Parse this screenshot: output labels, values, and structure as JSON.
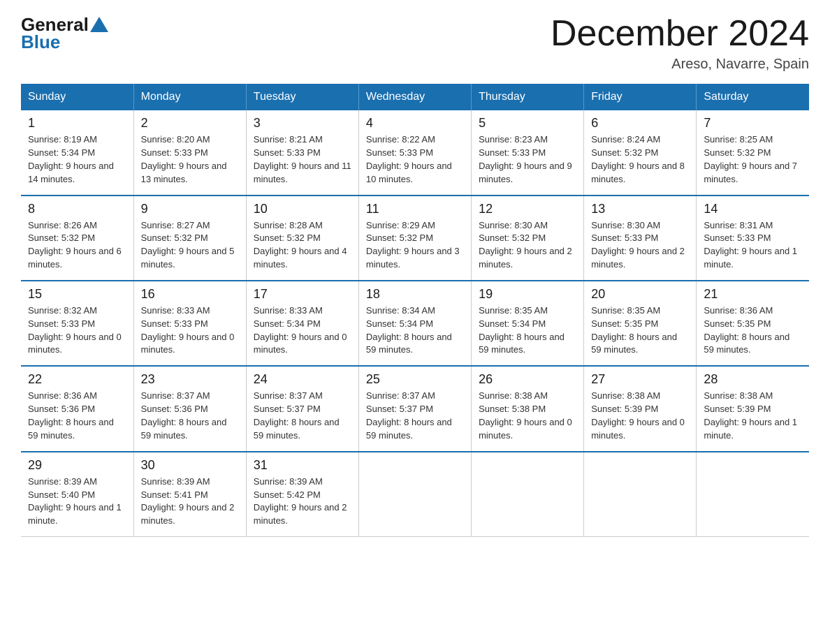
{
  "header": {
    "logo_general": "General",
    "logo_blue": "Blue",
    "title": "December 2024",
    "subtitle": "Areso, Navarre, Spain"
  },
  "days_of_week": [
    "Sunday",
    "Monday",
    "Tuesday",
    "Wednesday",
    "Thursday",
    "Friday",
    "Saturday"
  ],
  "weeks": [
    [
      {
        "day": "1",
        "sunrise": "8:19 AM",
        "sunset": "5:34 PM",
        "daylight": "9 hours and 14 minutes."
      },
      {
        "day": "2",
        "sunrise": "8:20 AM",
        "sunset": "5:33 PM",
        "daylight": "9 hours and 13 minutes."
      },
      {
        "day": "3",
        "sunrise": "8:21 AM",
        "sunset": "5:33 PM",
        "daylight": "9 hours and 11 minutes."
      },
      {
        "day": "4",
        "sunrise": "8:22 AM",
        "sunset": "5:33 PM",
        "daylight": "9 hours and 10 minutes."
      },
      {
        "day": "5",
        "sunrise": "8:23 AM",
        "sunset": "5:33 PM",
        "daylight": "9 hours and 9 minutes."
      },
      {
        "day": "6",
        "sunrise": "8:24 AM",
        "sunset": "5:32 PM",
        "daylight": "9 hours and 8 minutes."
      },
      {
        "day": "7",
        "sunrise": "8:25 AM",
        "sunset": "5:32 PM",
        "daylight": "9 hours and 7 minutes."
      }
    ],
    [
      {
        "day": "8",
        "sunrise": "8:26 AM",
        "sunset": "5:32 PM",
        "daylight": "9 hours and 6 minutes."
      },
      {
        "day": "9",
        "sunrise": "8:27 AM",
        "sunset": "5:32 PM",
        "daylight": "9 hours and 5 minutes."
      },
      {
        "day": "10",
        "sunrise": "8:28 AM",
        "sunset": "5:32 PM",
        "daylight": "9 hours and 4 minutes."
      },
      {
        "day": "11",
        "sunrise": "8:29 AM",
        "sunset": "5:32 PM",
        "daylight": "9 hours and 3 minutes."
      },
      {
        "day": "12",
        "sunrise": "8:30 AM",
        "sunset": "5:32 PM",
        "daylight": "9 hours and 2 minutes."
      },
      {
        "day": "13",
        "sunrise": "8:30 AM",
        "sunset": "5:33 PM",
        "daylight": "9 hours and 2 minutes."
      },
      {
        "day": "14",
        "sunrise": "8:31 AM",
        "sunset": "5:33 PM",
        "daylight": "9 hours and 1 minute."
      }
    ],
    [
      {
        "day": "15",
        "sunrise": "8:32 AM",
        "sunset": "5:33 PM",
        "daylight": "9 hours and 0 minutes."
      },
      {
        "day": "16",
        "sunrise": "8:33 AM",
        "sunset": "5:33 PM",
        "daylight": "9 hours and 0 minutes."
      },
      {
        "day": "17",
        "sunrise": "8:33 AM",
        "sunset": "5:34 PM",
        "daylight": "9 hours and 0 minutes."
      },
      {
        "day": "18",
        "sunrise": "8:34 AM",
        "sunset": "5:34 PM",
        "daylight": "8 hours and 59 minutes."
      },
      {
        "day": "19",
        "sunrise": "8:35 AM",
        "sunset": "5:34 PM",
        "daylight": "8 hours and 59 minutes."
      },
      {
        "day": "20",
        "sunrise": "8:35 AM",
        "sunset": "5:35 PM",
        "daylight": "8 hours and 59 minutes."
      },
      {
        "day": "21",
        "sunrise": "8:36 AM",
        "sunset": "5:35 PM",
        "daylight": "8 hours and 59 minutes."
      }
    ],
    [
      {
        "day": "22",
        "sunrise": "8:36 AM",
        "sunset": "5:36 PM",
        "daylight": "8 hours and 59 minutes."
      },
      {
        "day": "23",
        "sunrise": "8:37 AM",
        "sunset": "5:36 PM",
        "daylight": "8 hours and 59 minutes."
      },
      {
        "day": "24",
        "sunrise": "8:37 AM",
        "sunset": "5:37 PM",
        "daylight": "8 hours and 59 minutes."
      },
      {
        "day": "25",
        "sunrise": "8:37 AM",
        "sunset": "5:37 PM",
        "daylight": "8 hours and 59 minutes."
      },
      {
        "day": "26",
        "sunrise": "8:38 AM",
        "sunset": "5:38 PM",
        "daylight": "9 hours and 0 minutes."
      },
      {
        "day": "27",
        "sunrise": "8:38 AM",
        "sunset": "5:39 PM",
        "daylight": "9 hours and 0 minutes."
      },
      {
        "day": "28",
        "sunrise": "8:38 AM",
        "sunset": "5:39 PM",
        "daylight": "9 hours and 1 minute."
      }
    ],
    [
      {
        "day": "29",
        "sunrise": "8:39 AM",
        "sunset": "5:40 PM",
        "daylight": "9 hours and 1 minute."
      },
      {
        "day": "30",
        "sunrise": "8:39 AM",
        "sunset": "5:41 PM",
        "daylight": "9 hours and 2 minutes."
      },
      {
        "day": "31",
        "sunrise": "8:39 AM",
        "sunset": "5:42 PM",
        "daylight": "9 hours and 2 minutes."
      },
      null,
      null,
      null,
      null
    ]
  ],
  "labels": {
    "sunrise": "Sunrise:",
    "sunset": "Sunset:",
    "daylight": "Daylight:"
  }
}
